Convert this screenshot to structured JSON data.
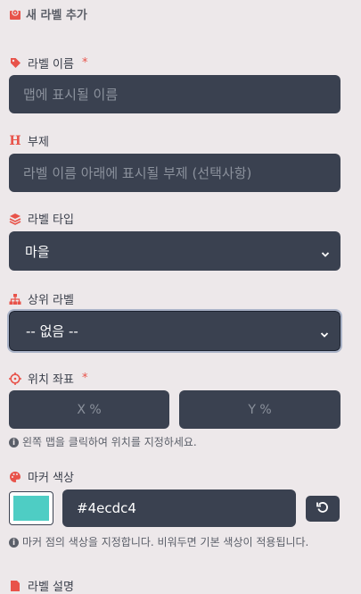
{
  "section": {
    "title": "새 라벨 추가",
    "icon": "map-marker-icon"
  },
  "name_field": {
    "label": "라벨 이름",
    "required_mark": "*",
    "placeholder": "맵에 표시될 이름",
    "value": ""
  },
  "subtitle_field": {
    "label": "부제",
    "icon_glyph": "H",
    "placeholder": "라벨 이름 아래에 표시될 부제 (선택사항)",
    "value": ""
  },
  "type_field": {
    "label": "라벨 타입",
    "selected": "마을"
  },
  "parent_field": {
    "label": "상위 라벨",
    "selected": "-- 없음 --"
  },
  "coords": {
    "label": "위치 좌표",
    "required_mark": "*",
    "x_placeholder": "X %",
    "y_placeholder": "Y %",
    "hint": "왼쪽 맵을 클릭하여 위치를 지정하세요."
  },
  "color_field": {
    "label": "마커 색상",
    "swatch_color": "#4ecdc4",
    "value": "#4ecdc4",
    "hint": "마커 점의 색상을 지정합니다. 비워두면 기본 색상이 적용됩니다."
  },
  "description_field": {
    "label": "라벨 설명"
  },
  "colors": {
    "accent": "#e8534a",
    "input_bg": "#3a4150",
    "page_bg": "#ede8ea"
  }
}
